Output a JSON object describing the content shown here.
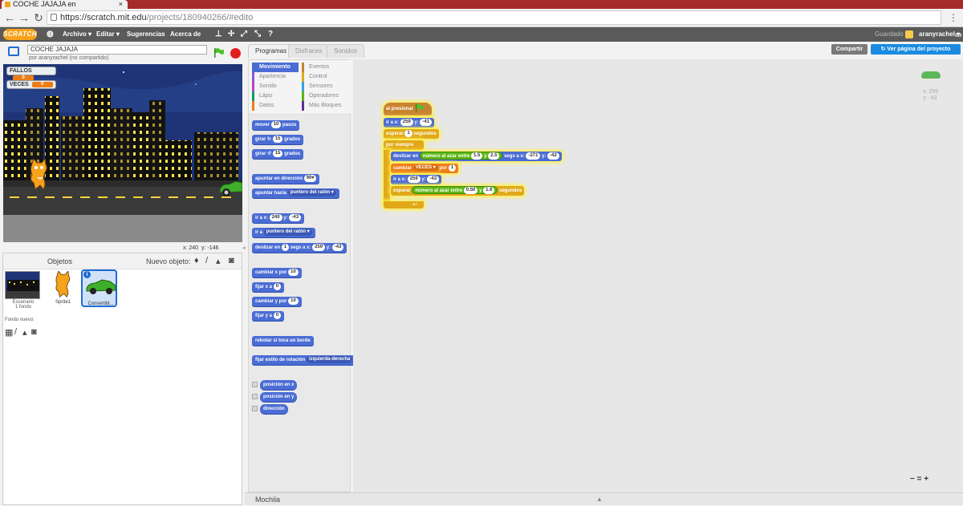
{
  "browser": {
    "tab_title": "COCHE JAJAJA en",
    "tab_close": "×",
    "url_host": "https://scratch.mit.edu",
    "url_path": "/projects/180940266/#edito",
    "menu_icon": "⋮"
  },
  "menubar": {
    "logo": "SCRATCH",
    "globe_icon": "globe-icon",
    "file": "Archivo ▾",
    "edit": "Editar ▾",
    "tips": "Sugerencias",
    "about": "Acerca de",
    "saved": "Guardado",
    "user": "aranyrachel ▾"
  },
  "stage_header": {
    "project_title": "COCHE JAJAJA",
    "byline": "por aranyrachel (no compartido)"
  },
  "stage": {
    "monitors": [
      {
        "label": "FALLOS",
        "value": "0"
      },
      {
        "label": "VECES",
        "value": "0"
      }
    ],
    "x": "x: 240",
    "y": "y: -146"
  },
  "sprite_pane": {
    "title": "Objetos",
    "new_object": "Nuevo objeto:",
    "stage_label": "Escenario",
    "stage_count": "1 fondo",
    "new_backdrop": "Fondo nuevo:",
    "sprites": [
      {
        "name": "Sprite1"
      },
      {
        "name": "Convertibl..."
      }
    ]
  },
  "tabs": {
    "scripts": "Programas",
    "costumes": "Disfraces",
    "sounds": "Sonidos",
    "share": "Compartir",
    "view_project": "Ver página del proyecto"
  },
  "categories": {
    "left": [
      "Movimiento",
      "Apariencia",
      "Sonido",
      "Lápiz",
      "Datos"
    ],
    "right": [
      "Eventos",
      "Control",
      "Sensores",
      "Operadores",
      "Más Bloques"
    ],
    "colors_left": [
      "#4a6cd4",
      "#8a55d7",
      "#bb42c3",
      "#0e9a6c",
      "#ee7d16"
    ],
    "colors_right": [
      "#c88330",
      "#e1a91a",
      "#2ca5e2",
      "#5cb712",
      "#632d99"
    ]
  },
  "palette": {
    "move": "mover",
    "move_n": "10",
    "move_suffix": "pasos",
    "turn_right": "girar",
    "turn_right_n": "15",
    "turn_right_suffix": "grados",
    "turn_left": "girar",
    "turn_left_n": "15",
    "turn_left_suffix": "grados",
    "point_dir": "apuntar en dirección",
    "point_dir_n": "90▾",
    "point_towards": "apuntar hacia",
    "point_towards_v": "puntero del ratón ▾",
    "goto_xy": "ir a x:",
    "goto_x": "240",
    "goto_y_label": "y:",
    "goto_y": "-43",
    "goto": "ir a",
    "goto_v": "puntero del ratón ▾",
    "glide": "deslizar en",
    "glide_n": "1",
    "glide_mid": "segs a x:",
    "glide_x": "259",
    "glide_y_label": "y:",
    "glide_y": "-43",
    "change_x": "cambiar x por",
    "change_x_n": "10",
    "set_x": "fijar x a",
    "set_x_n": "0",
    "change_y": "cambiar y por",
    "change_y_n": "10",
    "set_y": "fijar y a",
    "set_y_n": "0",
    "bounce": "rebotar si toca un borde",
    "rotation_style": "fijar estilo de rotación",
    "rotation_style_v": "izquierda-derecha",
    "x_position": "posición en x",
    "y_position": "posición en y",
    "direction": "dirección"
  },
  "script": {
    "hat": "al presionar",
    "goto": "ir a x:",
    "goto_x": "259",
    "goto_y_label": "y:",
    "goto_y": "-41",
    "wait": "esperar",
    "wait_n": "1",
    "wait_suffix": "segundos",
    "forever": "por siempre",
    "glide": "deslizar en",
    "rand1": "número al azar entre",
    "rand1_a": "1.5",
    "rand1_y": "y",
    "rand1_b": "2.5",
    "glide_mid": "segs a x:",
    "glide_x": "-271",
    "glide_y_label": "y:",
    "glide_y": "-42",
    "change_var": "cambiar",
    "var_name": "VECES ▾",
    "change_by": "por",
    "change_n": "1",
    "goto2": "ir a x:",
    "goto2_x": "259",
    "goto2_y_label": "y:",
    "goto2_y": "-43",
    "wait2": "esperar",
    "rand2": "número al azar entre",
    "rand2_a": "0.50",
    "rand2_y": "y",
    "rand2_b": "1.6",
    "wait2_suffix": "segundos"
  },
  "scripts_area": {
    "mouse_x": "x: 259",
    "mouse_y": "y: -43",
    "zoom_out": "−",
    "zoom_reset": "=",
    "zoom_in": "+"
  },
  "backpack": "Mochila"
}
